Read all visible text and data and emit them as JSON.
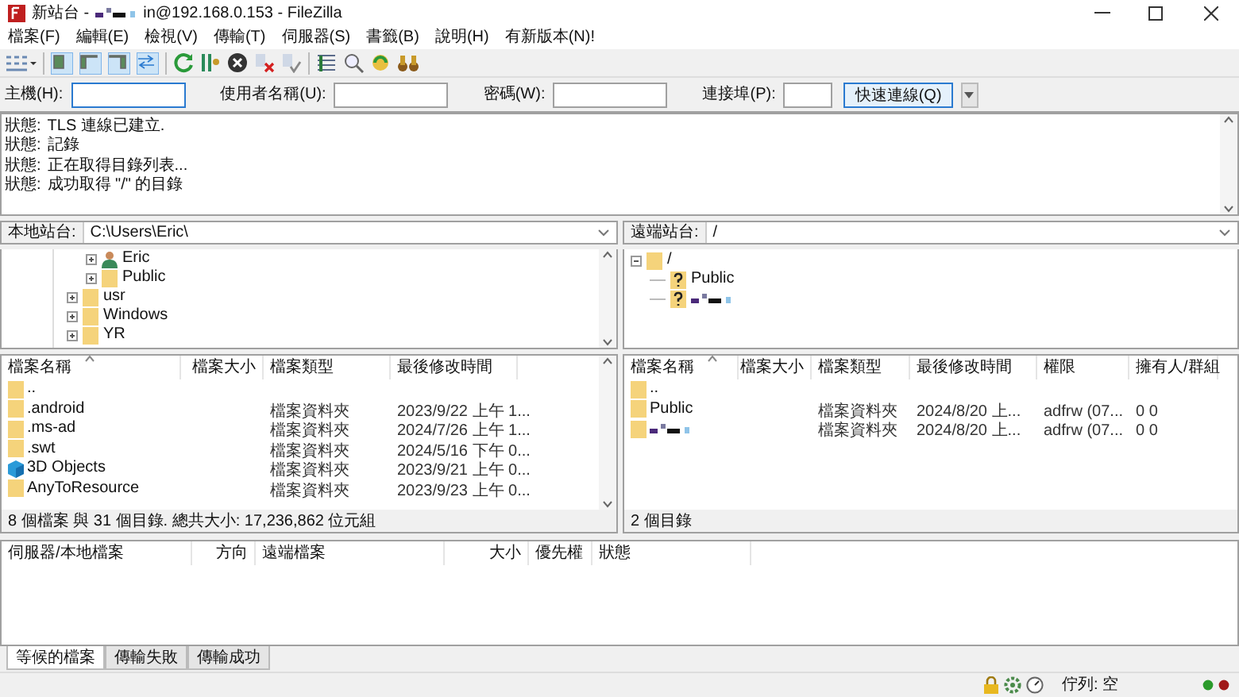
{
  "window": {
    "title_prefix": "新站台 -",
    "title_redacted": true,
    "title_suffix": "in@192.168.0.153 - FileZilla"
  },
  "menu": [
    "檔案(F)",
    "編輯(E)",
    "檢視(V)",
    "傳輸(T)",
    "伺服器(S)",
    "書籤(B)",
    "說明(H)",
    "有新版本(N)!"
  ],
  "view_toggles": [
    {
      "on": true
    },
    {
      "on": true
    },
    {
      "on": true
    },
    {
      "on": true
    }
  ],
  "quickconnect": {
    "fields": [
      {
        "label": "主機(H):",
        "focused": true
      },
      {
        "label": "使用者名稱(U):",
        "focused": false
      },
      {
        "label": "密碼(W):",
        "focused": false
      },
      {
        "label": "連接埠(P):",
        "focused": false
      }
    ],
    "button": "快速連線(Q)"
  },
  "log": [
    {
      "label": "狀態:",
      "message": "TLS 連線已建立."
    },
    {
      "label": "狀態:",
      "message": "記錄"
    },
    {
      "label": "狀態:",
      "message": "正在取得目錄列表..."
    },
    {
      "label": "狀態:",
      "message": "成功取得 \"/\" 的目錄"
    }
  ],
  "local": {
    "label": "本地站台:",
    "path": "C:\\Users\\Eric\\",
    "tree": [
      {
        "children": [
          {
            "name": "Eric",
            "kind": "user",
            "expanded": false
          },
          {
            "name": "Public",
            "kind": "folder",
            "expanded": false
          }
        ]
      },
      {
        "name": "usr",
        "kind": "folder",
        "expanded": false
      },
      {
        "name": "Windows",
        "kind": "folder",
        "expanded": false
      },
      {
        "name": "YR",
        "kind": "folder",
        "expanded": false
      }
    ],
    "columns": [
      "檔案名稱",
      "檔案大小",
      "檔案類型",
      "最後修改時間"
    ],
    "rows": [
      {
        "kind": "folder",
        "name": ".."
      },
      {
        "kind": "folder",
        "name": ".android",
        "type": "檔案資料夾",
        "modified": "2023/9/22 上午 1..."
      },
      {
        "kind": "folder",
        "name": ".ms-ad",
        "type": "檔案資料夾",
        "modified": "2024/7/26 上午 1..."
      },
      {
        "kind": "folder",
        "name": ".swt",
        "type": "檔案資料夾",
        "modified": "2024/5/16 下午 0..."
      },
      {
        "kind": "cube",
        "name": "3D Objects",
        "type": "檔案資料夾",
        "modified": "2023/9/21 上午 0..."
      },
      {
        "kind": "folder",
        "name": "AnyToResource",
        "type": "檔案資料夾",
        "modified": "2023/9/23 上午 0..."
      }
    ],
    "status": "8 個檔案 與 31 個目錄. 總共大小: 17,236,862 位元組"
  },
  "remote": {
    "label": "遠端站台:",
    "path": "/",
    "tree": [
      {
        "name": "/",
        "kind": "folder",
        "expanded": true,
        "children": [
          {
            "name": "Public",
            "kind": "unknown"
          },
          {
            "redacted": true,
            "kind": "unknown"
          }
        ]
      }
    ],
    "columns": [
      "檔案名稱",
      "檔案大小",
      "檔案類型",
      "最後修改時間",
      "權限",
      "擁有人/群組"
    ],
    "rows": [
      {
        "kind": "folder",
        "name": ".."
      },
      {
        "kind": "folder",
        "name": "Public",
        "type": "檔案資料夾",
        "modified": "2024/8/20 上...",
        "permissions": "adfrw (07...",
        "owner": "0 0"
      },
      {
        "kind": "folder",
        "redacted": true,
        "type": "檔案資料夾",
        "modified": "2024/8/20 上...",
        "permissions": "adfrw (07...",
        "owner": "0 0"
      }
    ],
    "status": "2 個目錄"
  },
  "queue": {
    "columns": [
      "伺服器/本地檔案",
      "方向",
      "遠端檔案",
      "大小",
      "優先權",
      "狀態"
    ]
  },
  "tabs": [
    {
      "label": "等候的檔案",
      "selected": true
    },
    {
      "label": "傳輸失敗",
      "selected": false
    },
    {
      "label": "傳輸成功",
      "selected": false
    }
  ],
  "status_bar": {
    "queue": "佇列: 空"
  }
}
